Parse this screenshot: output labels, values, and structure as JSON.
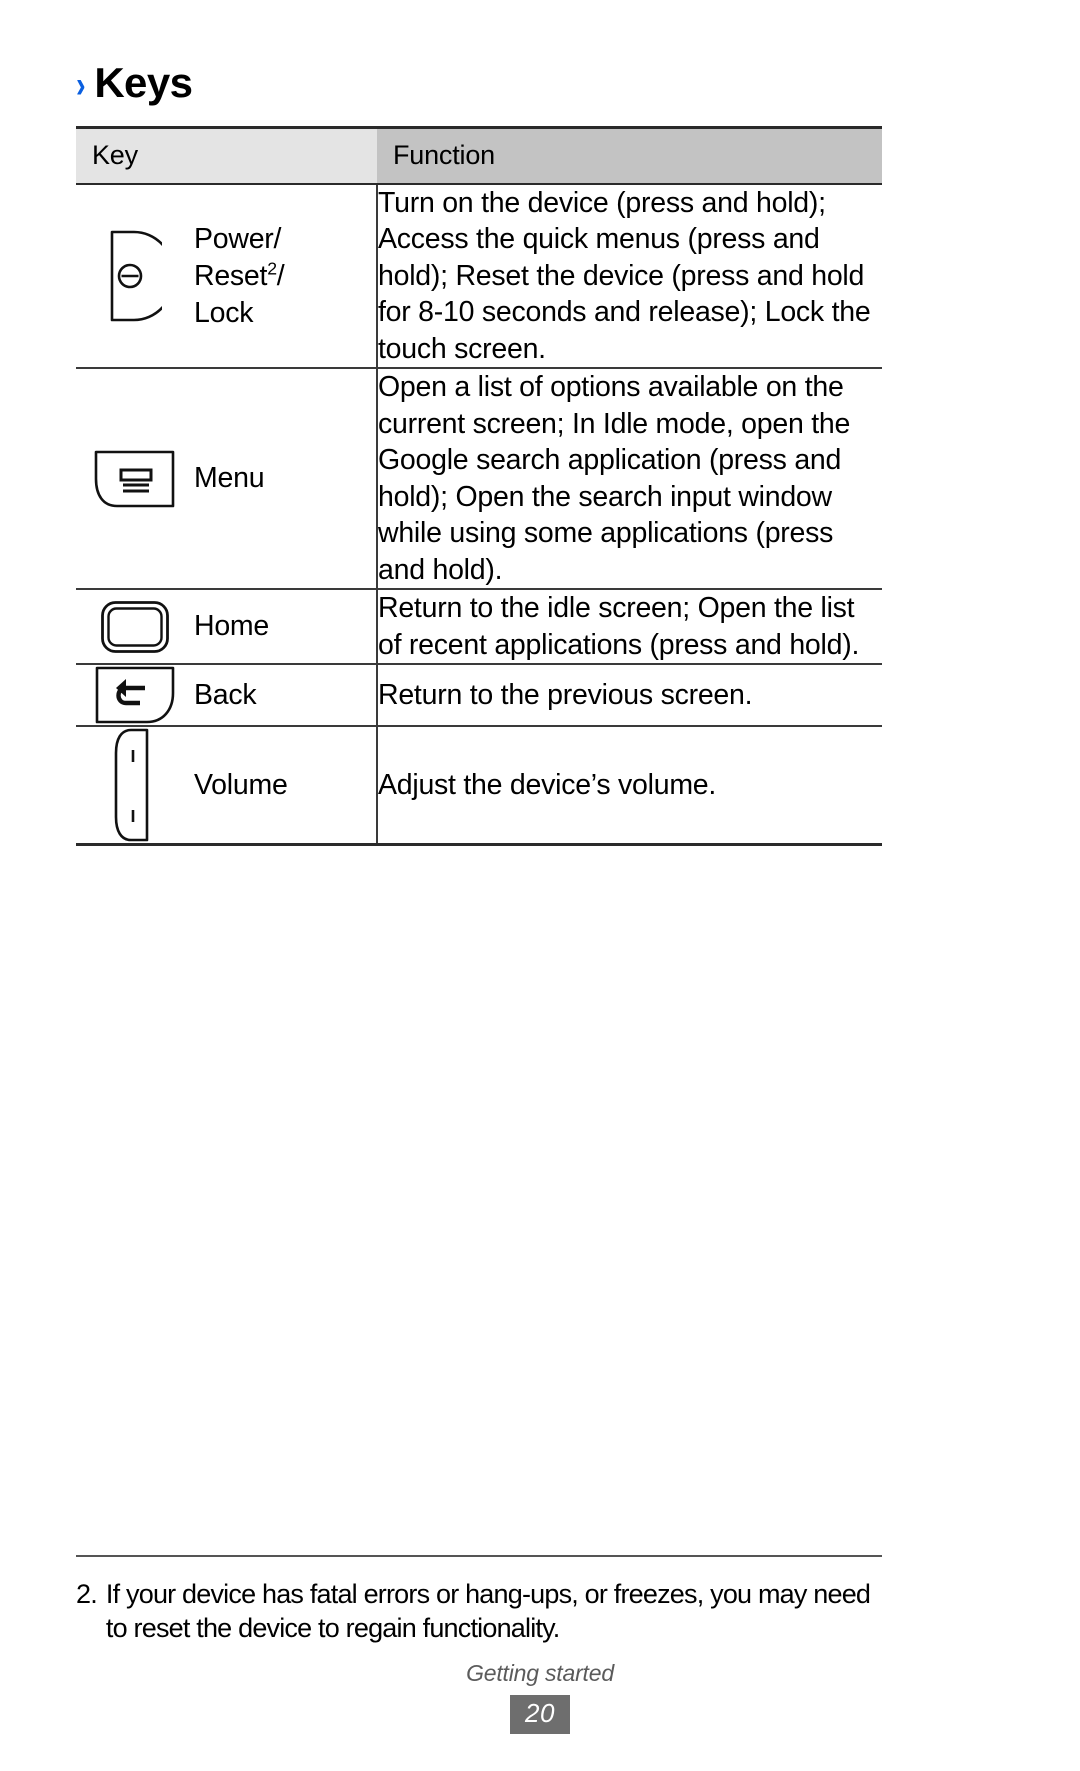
{
  "heading": {
    "chevron": "›",
    "title": "Keys"
  },
  "table": {
    "columns": [
      "Key",
      "Function"
    ],
    "rows": [
      {
        "icon": "power-key-icon",
        "label_html": "Power/ Reset2/ Lock",
        "label_line1": "Power/",
        "label_line2_pre": "Reset",
        "label_line2_sup": "2",
        "label_line2_post": "/",
        "label_line3": "Lock",
        "function": "Turn on the device (press and hold); Access the quick menus (press and hold); Reset the device (press and hold for 8-10 seconds and release); Lock the touch screen."
      },
      {
        "icon": "menu-key-icon",
        "label": "Menu",
        "function": "Open a list of options available on the current screen; In Idle mode, open the Google search application (press and hold); Open the search input window while using some applications (press and hold)."
      },
      {
        "icon": "home-key-icon",
        "label": "Home",
        "function": "Return to the idle screen; Open the list of recent applications (press and hold)."
      },
      {
        "icon": "back-key-icon",
        "label": "Back",
        "function": "Return to the previous screen."
      },
      {
        "icon": "volume-key-icon",
        "label": "Volume",
        "function": "Adjust the device’s volume."
      }
    ]
  },
  "footnote": {
    "marker": "2.",
    "text": "If your device has fatal errors or hang-ups, or freezes, you may need to reset the device to regain functionality."
  },
  "footer": {
    "section": "Getting started",
    "page": "20"
  },
  "colors": {
    "accent": "#0a5fe0",
    "header_key_bg": "#e4e4e4",
    "header_func_bg": "#c3c3c3",
    "page_box_bg": "#6e6e6e",
    "footer_text": "#5b5b5b"
  }
}
